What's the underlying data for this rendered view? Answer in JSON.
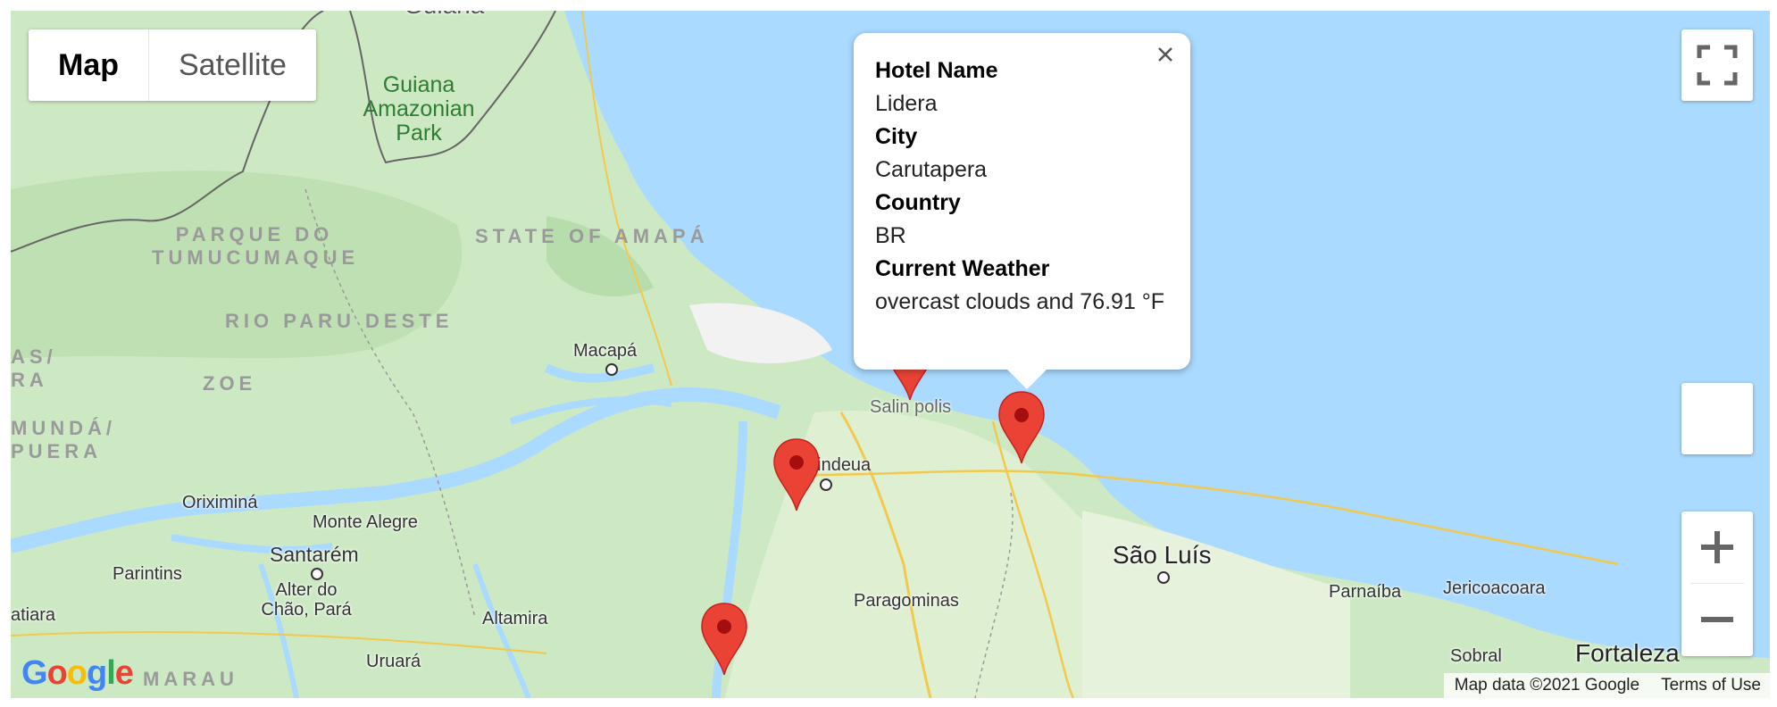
{
  "map_type": {
    "map": "Map",
    "satellite": "Satellite"
  },
  "info_window": {
    "rows": [
      {
        "key": "Hotel Name",
        "value": "Lidera"
      },
      {
        "key": "City",
        "value": "Carutapera"
      },
      {
        "key": "Country",
        "value": "BR"
      },
      {
        "key": "Current Weather",
        "value": "overcast clouds and 76.91 °F"
      }
    ]
  },
  "regions": {
    "amapa": "STATE OF AMAPÁ",
    "tumucumaque": "PARQUE DO TUMUCUMAQUE",
    "paru": "RIO PARU DESTE",
    "zoe": "ZOE",
    "mundurucania": "MUNDÁ/ PUERA",
    "tas": "AS/ RA",
    "maraua": "MARAU"
  },
  "parks": {
    "guiana": "Guiana Amazonian Park"
  },
  "cities": {
    "macapa": "Macapá",
    "salinopolis": "Salin polis",
    "ananindeua": "nindeua",
    "sao_luis": "São Luís",
    "oriximina": "Oriximiná",
    "monte_alegre": "Monte Alegre",
    "santarem": "Santarém",
    "parintins": "Parintins",
    "alter_do_chao": "Alter do Chão, Pará",
    "altamira": "Altamira",
    "uruara": "Uruará",
    "paragominas": "Paragominas",
    "parnaiba": "Parnaíba",
    "jericoacoara": "Jericoacoara",
    "sobral": "Sobral",
    "fortaleza": "Fortaleza",
    "atiara": "atiara",
    "guiana_top": "Guiana"
  },
  "attribution": {
    "map_data": "Map data ©2021 Google",
    "terms": "Terms of Use"
  },
  "logo": "Google",
  "colors": {
    "water": "#aadaff",
    "land": "#cde9c4",
    "marker": "#ea4335",
    "park_text": "#2e7d32"
  }
}
